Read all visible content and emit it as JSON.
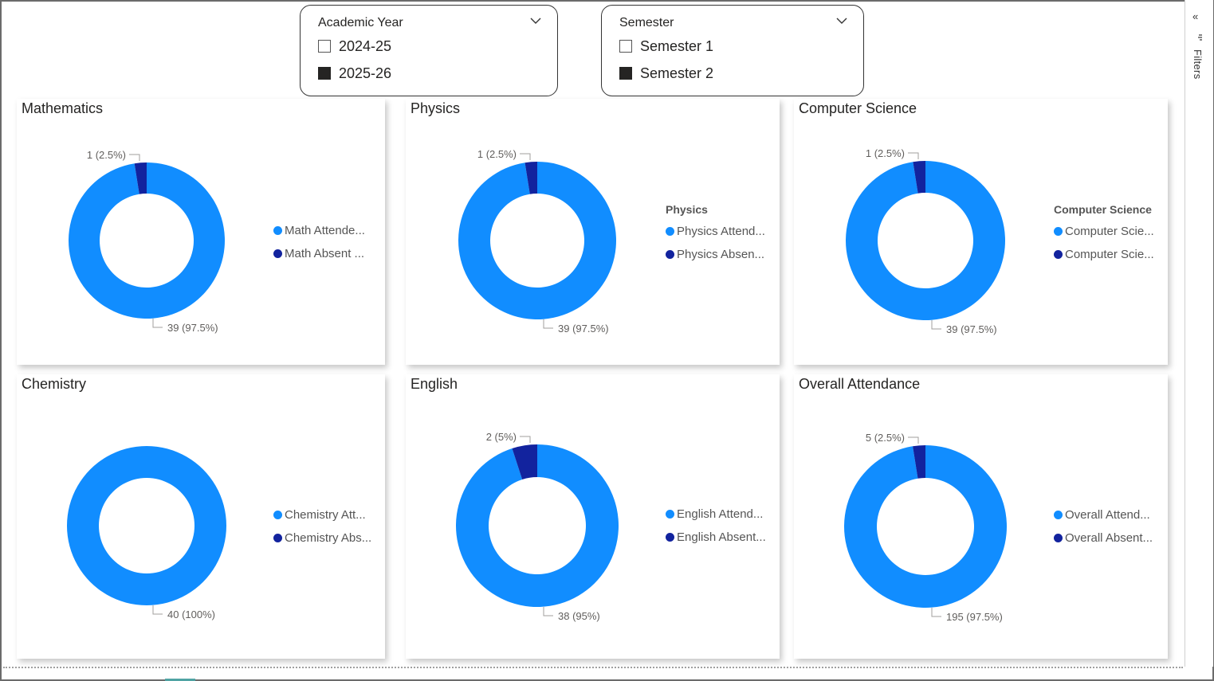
{
  "colors": {
    "attended": "#118dff",
    "absent": "#12239e",
    "frame": "#6b6b6b"
  },
  "filters_pane": {
    "label": "Filters",
    "collapse_icon": "double-chevron-left-icon",
    "filter_icon": "filter-icon"
  },
  "slicers": [
    {
      "title": "Academic Year",
      "options": [
        {
          "label": "2024-25",
          "checked": false
        },
        {
          "label": "2025-26",
          "checked": true
        }
      ]
    },
    {
      "title": "Semester",
      "options": [
        {
          "label": "Semester 1",
          "checked": false
        },
        {
          "label": "Semester 2",
          "checked": true
        }
      ]
    }
  ],
  "chart_data": [
    {
      "type": "pie",
      "title": "Mathematics",
      "legend_title": "",
      "slices": [
        {
          "name": "Math Attende...",
          "value": 39,
          "label": "39 (97.5%)"
        },
        {
          "name": "Math Absent ...",
          "value": 1,
          "label": "1 (2.5%)"
        }
      ]
    },
    {
      "type": "pie",
      "title": "Physics",
      "legend_title": "Physics",
      "slices": [
        {
          "name": "Physics Attend...",
          "value": 39,
          "label": "39 (97.5%)"
        },
        {
          "name": "Physics Absen...",
          "value": 1,
          "label": "1 (2.5%)"
        }
      ]
    },
    {
      "type": "pie",
      "title": "Computer Science",
      "legend_title": "Computer Science",
      "slices": [
        {
          "name": "Computer Scie...",
          "value": 39,
          "label": "39 (97.5%)"
        },
        {
          "name": "Computer Scie...",
          "value": 1,
          "label": "1 (2.5%)"
        }
      ]
    },
    {
      "type": "pie",
      "title": "Chemistry",
      "legend_title": "",
      "slices": [
        {
          "name": "Chemistry Att...",
          "value": 40,
          "label": "40 (100%)"
        },
        {
          "name": "Chemistry Abs...",
          "value": 0,
          "label": ""
        }
      ]
    },
    {
      "type": "pie",
      "title": "English",
      "legend_title": "",
      "slices": [
        {
          "name": "English Attend...",
          "value": 38,
          "label": "38 (95%)"
        },
        {
          "name": "English Absent...",
          "value": 2,
          "label": "2 (5%)"
        }
      ]
    },
    {
      "type": "pie",
      "title": "Overall Attendance",
      "legend_title": "",
      "slices": [
        {
          "name": "Overall Attend...",
          "value": 195,
          "label": "195 (97.5%)"
        },
        {
          "name": "Overall Absent...",
          "value": 5,
          "label": "5 (2.5%)"
        }
      ]
    }
  ]
}
